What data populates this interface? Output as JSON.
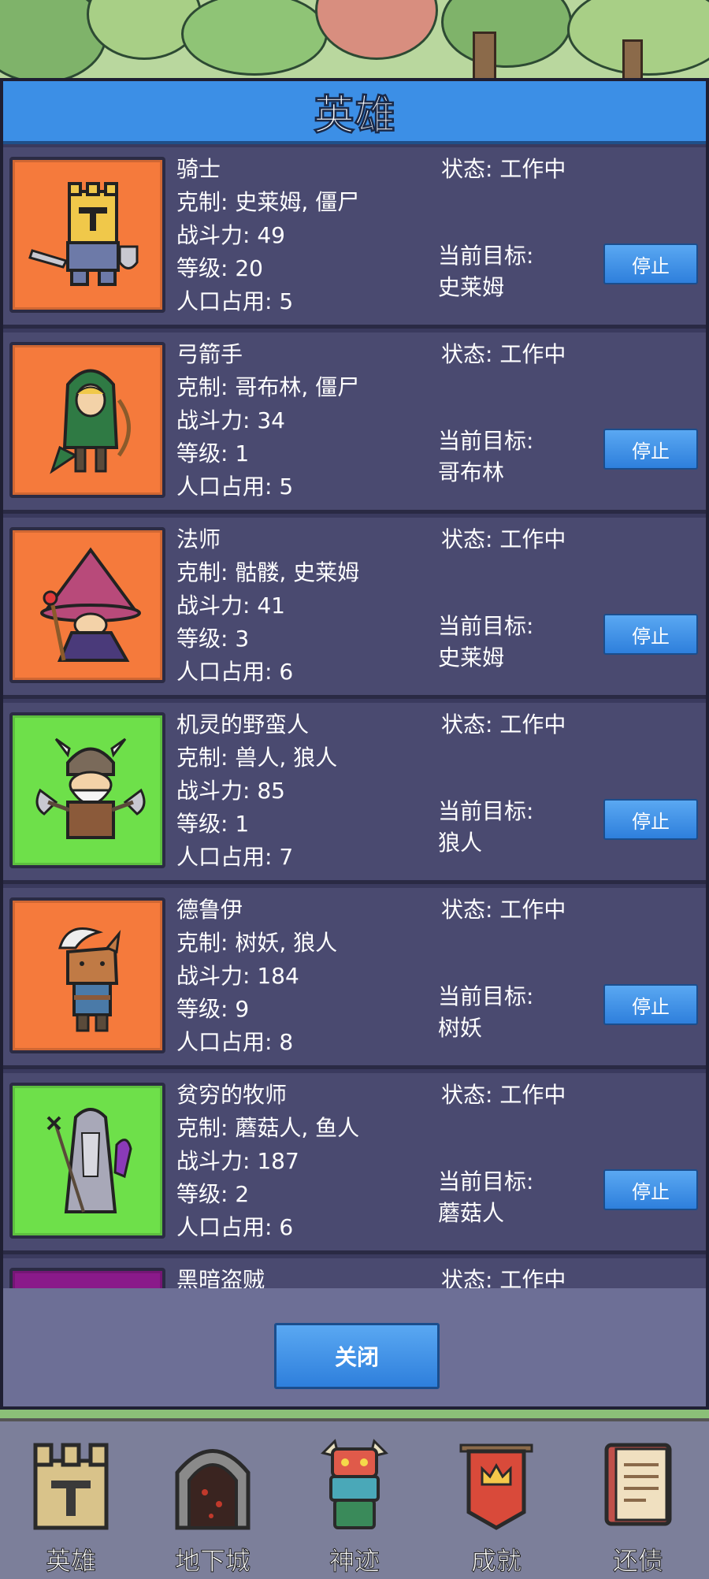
{
  "modal": {
    "title": "英雄",
    "close_label": "关闭"
  },
  "heroes": [
    {
      "name": "骑士",
      "counter": "克制: 史莱姆, 僵尸",
      "power": "战斗力: 49",
      "level": "等级: 20",
      "population": "人口占用: 5",
      "status": "状态: 工作中",
      "target_label": "当前目标:",
      "target": "史莱姆",
      "stop_label": "停止",
      "portrait_bg": "#f57a3c"
    },
    {
      "name": "弓箭手",
      "counter": "克制: 哥布林, 僵尸",
      "power": "战斗力: 34",
      "level": "等级: 1",
      "population": "人口占用: 5",
      "status": "状态: 工作中",
      "target_label": "当前目标:",
      "target": "哥布林",
      "stop_label": "停止",
      "portrait_bg": "#f57a3c"
    },
    {
      "name": "法师",
      "counter": "克制: 骷髅, 史莱姆",
      "power": "战斗力: 41",
      "level": "等级: 3",
      "population": "人口占用: 6",
      "status": "状态: 工作中",
      "target_label": "当前目标:",
      "target": "史莱姆",
      "stop_label": "停止",
      "portrait_bg": "#f57a3c"
    },
    {
      "name": "机灵的野蛮人",
      "counter": "克制: 兽人, 狼人",
      "power": "战斗力: 85",
      "level": "等级: 1",
      "population": "人口占用: 7",
      "status": "状态: 工作中",
      "target_label": "当前目标:",
      "target": "狼人",
      "stop_label": "停止",
      "portrait_bg": "#6ee04a"
    },
    {
      "name": "德鲁伊",
      "counter": "克制: 树妖, 狼人",
      "power": "战斗力: 184",
      "level": "等级: 9",
      "population": "人口占用: 8",
      "status": "状态: 工作中",
      "target_label": "当前目标:",
      "target": "树妖",
      "stop_label": "停止",
      "portrait_bg": "#f57a3c"
    },
    {
      "name": "贫穷的牧师",
      "counter": "克制: 蘑菇人, 鱼人",
      "power": "战斗力: 187",
      "level": "等级: 2",
      "population": "人口占用: 6",
      "status": "状态: 工作中",
      "target_label": "当前目标:",
      "target": "蘑菇人",
      "stop_label": "停止",
      "portrait_bg": "#6ee04a"
    },
    {
      "name": "黑暗盗贼",
      "status": "状态: 工作中",
      "portrait_bg": "#8a1a8a"
    }
  ],
  "nav": [
    {
      "label": "英雄",
      "icon": "castle-icon"
    },
    {
      "label": "地下城",
      "icon": "dungeon-gate-icon"
    },
    {
      "label": "神迹",
      "icon": "totem-icon"
    },
    {
      "label": "成就",
      "icon": "banner-crown-icon"
    },
    {
      "label": "还债",
      "icon": "ledger-book-icon"
    }
  ]
}
